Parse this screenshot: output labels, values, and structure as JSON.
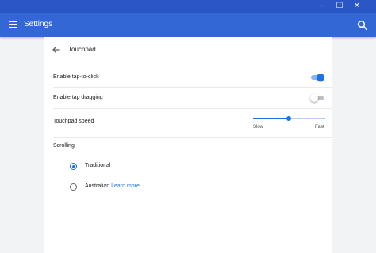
{
  "window": {
    "controls": [
      "–",
      "☐",
      "✕"
    ]
  },
  "header": {
    "title": "Settings",
    "menu_icon": "hamburger-menu-icon",
    "search_icon": "search-icon"
  },
  "page": {
    "back_icon": "arrow-back-icon",
    "title": "Touchpad"
  },
  "settings": {
    "tap_to_click": {
      "label": "Enable tap-to-click",
      "enabled": true
    },
    "tap_dragging": {
      "label": "Enable tap dragging",
      "enabled": false
    },
    "speed": {
      "label": "Touchpad speed",
      "min_label": "Slow",
      "max_label": "Fast",
      "level": 0.5
    }
  },
  "scrolling": {
    "title": "Scrolling",
    "options": [
      {
        "label": "Traditional",
        "selected": true
      },
      {
        "label": "Australian",
        "link": "Learn more",
        "selected": false
      }
    ]
  },
  "colors": {
    "titlebar": "#2a56c6",
    "appbar": "#3367d6",
    "accent": "#1a73e8",
    "background": "#f1f3f4"
  }
}
